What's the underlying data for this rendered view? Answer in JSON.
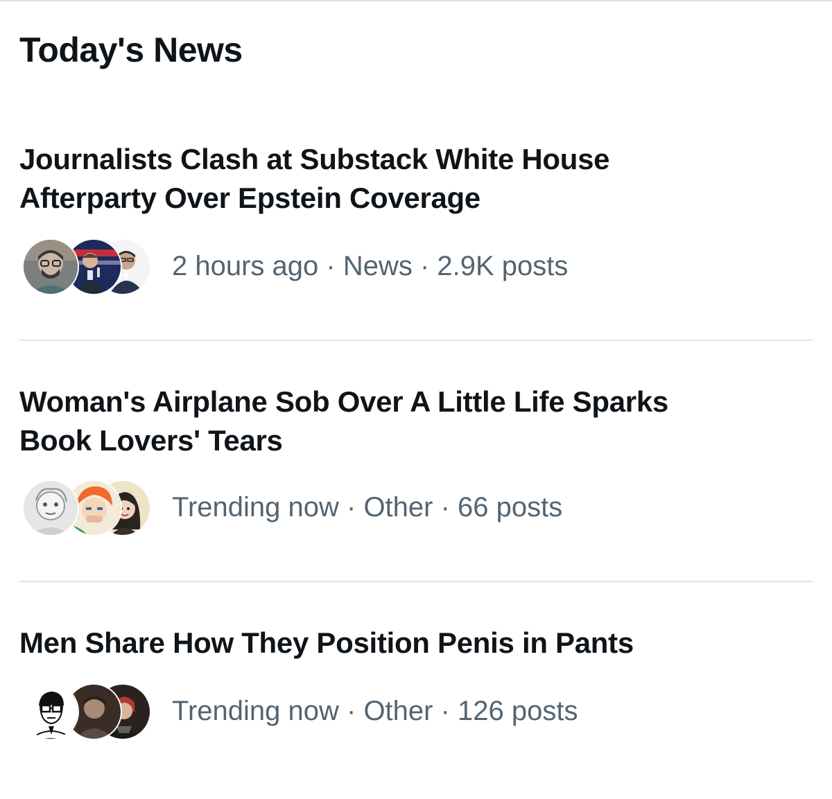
{
  "section": {
    "title": "Today's News"
  },
  "news": [
    {
      "headline_line1": "Journalists Clash at Substack White House",
      "headline_line2": "Afterparty Over Epstein Coverage",
      "time": "2 hours ago",
      "category": "News",
      "posts": "2.9K posts",
      "separator": " · "
    },
    {
      "headline_line1": "Woman's Airplane Sob Over A Little Life Sparks",
      "headline_line2": "Book Lovers' Tears",
      "time": "Trending now",
      "category": "Other",
      "posts": "66 posts",
      "separator": " · "
    },
    {
      "headline_line1": "Men Share How They Position Penis in Pants",
      "headline_line2": "",
      "time": "Trending now",
      "category": "Other",
      "posts": "126 posts",
      "separator": " · "
    }
  ],
  "colors": {
    "text_primary": "#0f1419",
    "text_secondary": "#536471",
    "divider": "#e1e4e6"
  },
  "icons": [
    "avatar-icon"
  ]
}
